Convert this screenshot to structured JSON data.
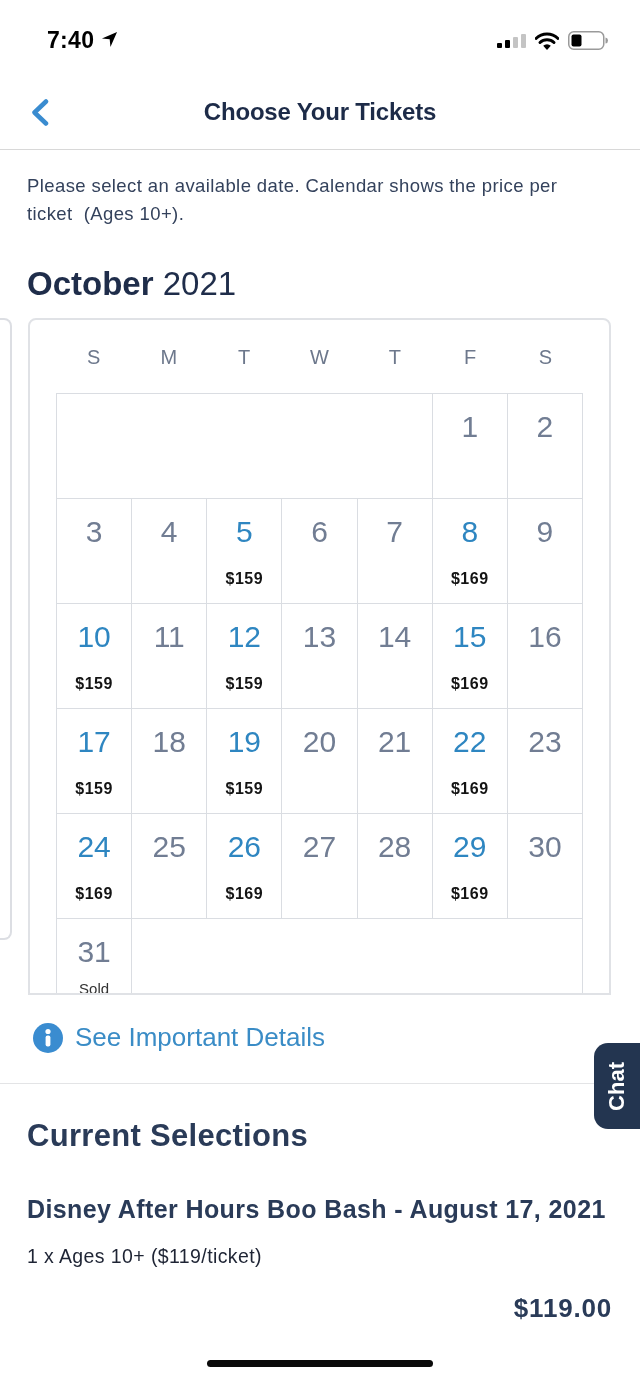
{
  "status_bar": {
    "time": "7:40"
  },
  "nav": {
    "title": "Choose Your Tickets"
  },
  "section": {
    "description": "Please select an available date. Calendar shows the price per ticket  (Ages 10+)."
  },
  "calendar": {
    "month": "**October** 2021",
    "weekdays": [
      "S",
      "M",
      "T",
      "W",
      "T",
      "F",
      "S"
    ],
    "weeks": [
      {
        "days": [
          {
            "day": "1",
            "available": false
          },
          {
            "day": "2",
            "available": false
          }
        ]
      },
      {
        "days": [
          {
            "day": "3",
            "available": false
          },
          {
            "day": "4",
            "available": false
          },
          {
            "day": "5",
            "available": true,
            "price": "$159"
          },
          {
            "day": "6",
            "available": false
          },
          {
            "day": "7",
            "available": false
          },
          {
            "day": "8",
            "available": true,
            "price": "$169"
          },
          {
            "day": "9",
            "available": false
          }
        ]
      },
      {
        "days": [
          {
            "day": "10",
            "available": true,
            "price": "$159"
          },
          {
            "day": "11",
            "available": false
          },
          {
            "day": "12",
            "available": true,
            "price": "$159"
          },
          {
            "day": "13",
            "available": false
          },
          {
            "day": "14",
            "available": false
          },
          {
            "day": "15",
            "available": true,
            "price": "$169"
          },
          {
            "day": "16",
            "available": false
          }
        ]
      },
      {
        "days": [
          {
            "day": "17",
            "available": true,
            "price": "$159"
          },
          {
            "day": "18",
            "available": false
          },
          {
            "day": "19",
            "available": true,
            "price": "$159"
          },
          {
            "day": "20",
            "available": false
          },
          {
            "day": "21",
            "available": false
          },
          {
            "day": "22",
            "available": true,
            "price": "$169"
          },
          {
            "day": "23",
            "available": false
          }
        ]
      },
      {
        "days": [
          {
            "day": "24",
            "available": true,
            "price": "$169"
          },
          {
            "day": "25",
            "available": false
          },
          {
            "day": "26",
            "available": true,
            "price": "$169"
          },
          {
            "day": "27",
            "available": false
          },
          {
            "day": "28",
            "available": false
          },
          {
            "day": "29",
            "available": true,
            "price": "$169"
          },
          {
            "day": "30",
            "available": false
          }
        ]
      },
      {
        "days": [
          {
            "day": "31",
            "available": false,
            "note": "Sold"
          }
        ]
      }
    ]
  },
  "details_link": {
    "label": "See Important Details"
  },
  "chat_tab": {
    "label": "Chat"
  },
  "current_selections": {
    "heading": "Current Selections",
    "items": [
      {
        "title": "Disney After Hours Boo Bash - August 17, 2021",
        "quantity": "1 x Ages 10+ ($119/ticket)",
        "total": "$119.00"
      }
    ]
  }
}
